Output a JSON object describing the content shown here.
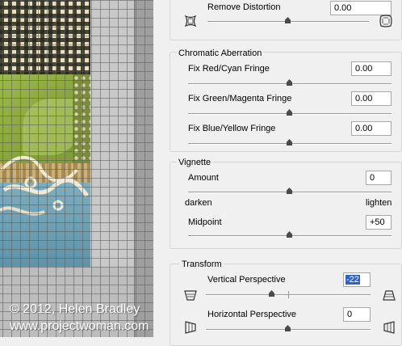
{
  "watermark": {
    "line1": "© 2012, Helen Bradley",
    "line2": "www.projectwoman.com"
  },
  "geometric": {
    "remove_distortion": {
      "label": "Remove Distortion",
      "value": "0.00",
      "left_icon": "pincushion-icon",
      "right_icon": "barrel-icon"
    }
  },
  "chromatic_aberration": {
    "title": "Chromatic Aberration",
    "rows": [
      {
        "label": "Fix Red/Cyan Fringe",
        "value": "0.00"
      },
      {
        "label": "Fix Green/Magenta Fringe",
        "value": "0.00"
      },
      {
        "label": "Fix Blue/Yellow Fringe",
        "value": "0.00"
      }
    ]
  },
  "vignette": {
    "title": "Vignette",
    "amount_label": "Amount",
    "amount_value": "0",
    "darken_label": "darken",
    "lighten_label": "lighten",
    "midpoint_label": "Midpoint",
    "midpoint_value": "+50"
  },
  "transform": {
    "title": "Transform",
    "vertical_label": "Vertical Perspective",
    "vertical_value": "-22",
    "horizontal_label": "Horizontal Perspective",
    "horizontal_value": "0"
  },
  "colors": {
    "selection": "#3061c9",
    "panel_bg": "#f0f0f0"
  }
}
